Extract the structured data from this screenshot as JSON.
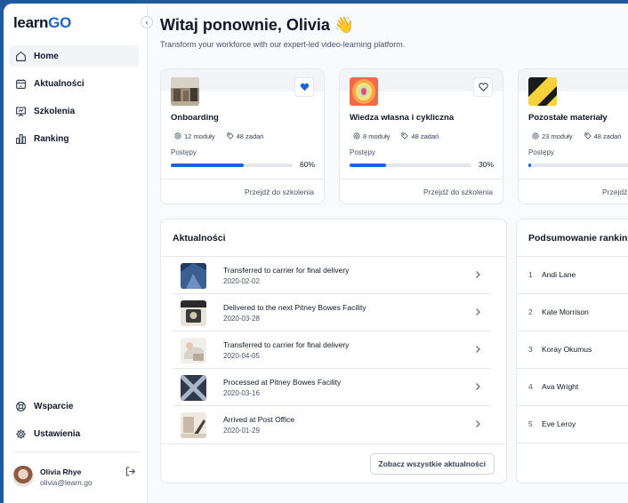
{
  "app": {
    "logo_learn": "learn",
    "logo_go": "GO",
    "collapse": "‹"
  },
  "nav": {
    "items": [
      {
        "label": "Home",
        "icon": "home-icon"
      },
      {
        "label": "Aktualności",
        "icon": "calendar-icon"
      },
      {
        "label": "Szkolenia",
        "icon": "presentation-icon"
      },
      {
        "label": "Ranking",
        "icon": "bar-chart-icon"
      }
    ],
    "bottom": [
      {
        "label": "Wsparcie",
        "icon": "lifebuoy-icon"
      },
      {
        "label": "Ustawienia",
        "icon": "gear-icon"
      }
    ]
  },
  "user": {
    "name": "Olivia Rhye",
    "email": "olivia@learn.go"
  },
  "header": {
    "title": "Witaj ponownie, Olivia 👋",
    "subtitle": "Transform your workforce with our expert-led video-learning platform."
  },
  "courses": [
    {
      "name": "Onboarding",
      "modules": "12 moduły",
      "tasks": "48 zadań",
      "progress_label": "Postępy",
      "progress": 60,
      "progress_text": "60%",
      "link": "Przejdź do szkolenia",
      "favorite": true
    },
    {
      "name": "Wiedza własna i cykliczna",
      "modules": "8 moduły",
      "tasks": "48 zadań",
      "progress_label": "Postępy",
      "progress": 30,
      "progress_text": "30%",
      "link": "Przejdź do szkolenia",
      "favorite": false
    },
    {
      "name": "Pozostałe materiały",
      "modules": "23 moduły",
      "tasks": "48 zadań",
      "progress_label": "Postępy",
      "progress": 2,
      "progress_text": "",
      "link": "Przejdź do szkolenia",
      "favorite": false
    }
  ],
  "news": {
    "title": "Aktualności",
    "items": [
      {
        "title": "Transferred to carrier for final delivery",
        "date": "2020-02-02"
      },
      {
        "title": "Delivered to the next Pitney Bowes Facility",
        "date": "2020-03-28"
      },
      {
        "title": "Transferred to carrier for final delivery",
        "date": "2020-04-05"
      },
      {
        "title": "Processed at Pitney Bowes Facility",
        "date": "2020-03-16"
      },
      {
        "title": "Arrived at Post Office",
        "date": "2020-01-29"
      }
    ],
    "button": "Zobacz wszystkie aktualności"
  },
  "ranking": {
    "title": "Podsumowanie rankingu",
    "items": [
      {
        "rank": "1",
        "name": "Andi Lane"
      },
      {
        "rank": "2",
        "name": "Kate Morrison"
      },
      {
        "rank": "3",
        "name": "Koray Okumus"
      },
      {
        "rank": "4",
        "name": "Ava Wright"
      },
      {
        "rank": "5",
        "name": "Eve Leroy"
      }
    ]
  },
  "colors": {
    "accent": "#1d64d8",
    "frame": "#1e5a9c",
    "background": "#f9fafb"
  }
}
